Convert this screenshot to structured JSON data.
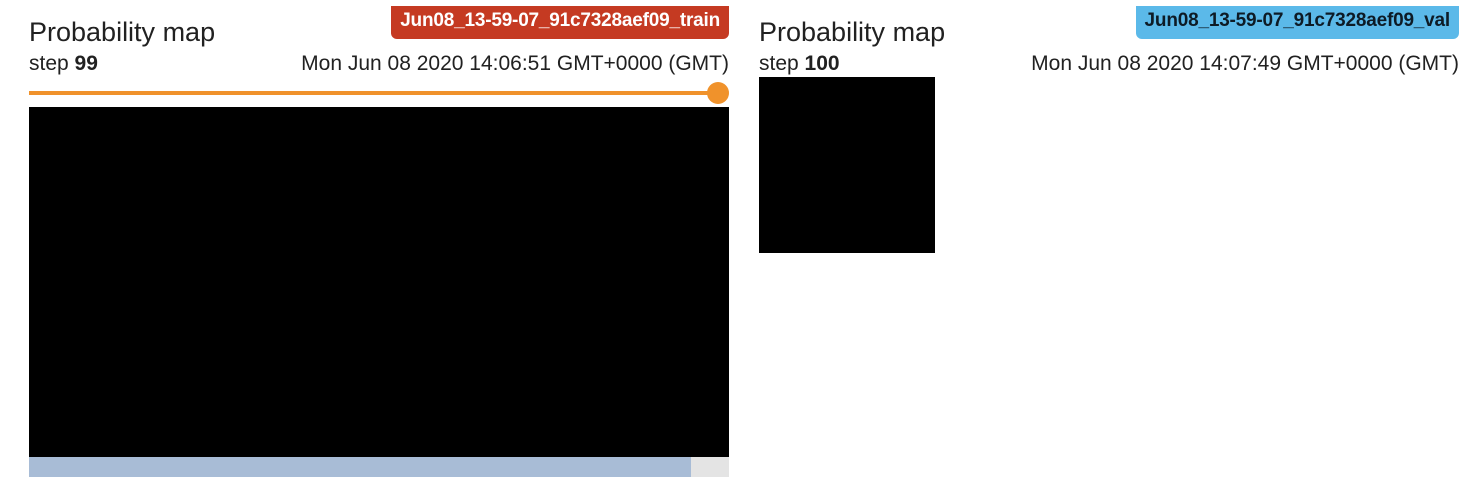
{
  "train_card": {
    "title": "Probability map",
    "run_name": "Jun08_13-59-07_91c7328aef09_train",
    "run_color": "#c53a22",
    "step_label": "step",
    "step_value": "99",
    "timestamp": "Mon Jun 08 2020 14:06:51 GMT+0000 (GMT)",
    "slider": {
      "value_fraction": 1.0,
      "color": "#f0922b"
    },
    "scrollbar": {
      "visible_fraction": 0.945
    }
  },
  "val_card": {
    "title": "Probability map",
    "run_name": "Jun08_13-59-07_91c7328aef09_val",
    "run_color": "#5bb9e9",
    "step_label": "step",
    "step_value": "100",
    "timestamp": "Mon Jun 08 2020 14:07:49 GMT+0000 (GMT)"
  }
}
